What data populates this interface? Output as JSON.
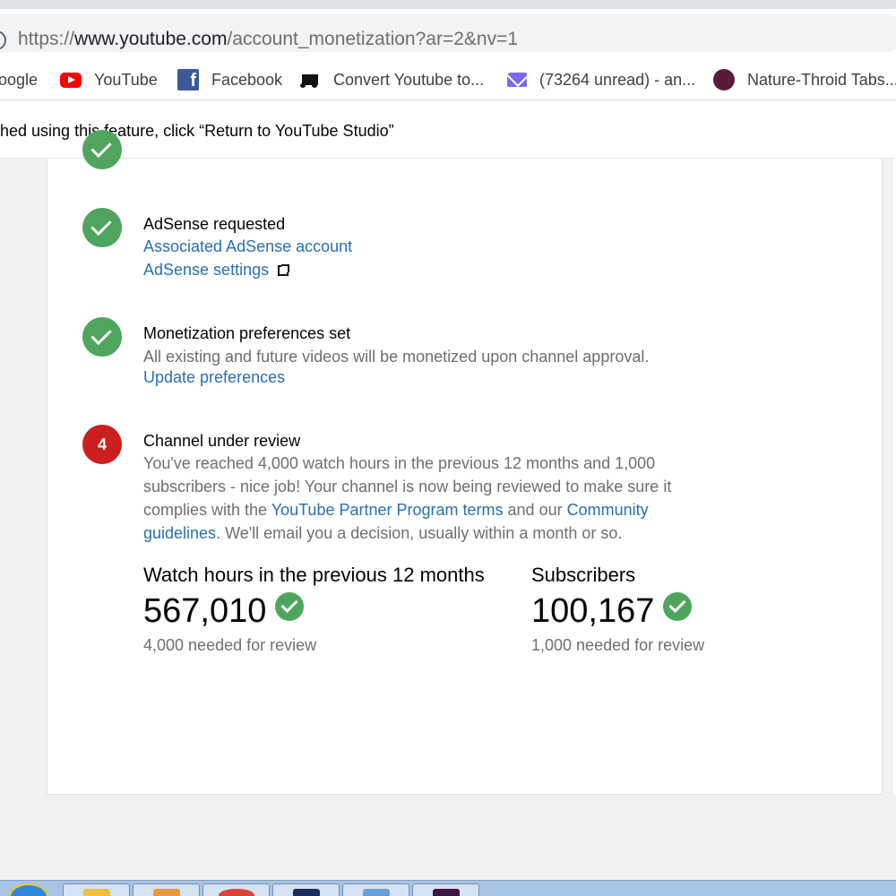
{
  "browser": {
    "url_scheme": "https://",
    "url_host": "www.youtube.com",
    "url_path": "/account_monetization?ar=2&nv=1",
    "info_glyph": "i",
    "bookmarks": [
      {
        "label": "oogle",
        "icon": "google"
      },
      {
        "label": "YouTube",
        "icon": "youtube-icon"
      },
      {
        "label": "Facebook",
        "icon": "facebook-icon"
      },
      {
        "label": "Convert Youtube to...",
        "icon": "music-note-icon"
      },
      {
        "label": "(73264 unread) - an...",
        "icon": "mail-icon"
      },
      {
        "label": "Nature-Throid Tabs...",
        "icon": "circle-icon"
      }
    ]
  },
  "banner": {
    "text": "hed using this feature, click “Return to YouTube Studio”"
  },
  "steps": {
    "adsense": {
      "title": "AdSense requested",
      "link1": "Associated AdSense account",
      "link2": "AdSense settings"
    },
    "monetization": {
      "title": "Monetization preferences set",
      "description": "All existing and future videos will be monetized upon channel approval.",
      "link": "Update preferences"
    },
    "review": {
      "number": "4",
      "title": "Channel under review",
      "desc_part1": "You've reached 4,000 watch hours in the previous 12 months and 1,000 subscribers - nice job! Your channel is now being reviewed to make sure it complies with the ",
      "link_ypp": "YouTube Partner Program terms",
      "desc_part2": " and our ",
      "link_community": "Community guidelines",
      "desc_part3": ". We'll email you a decision, usually within a month or so."
    }
  },
  "stats": {
    "watch": {
      "label": "Watch hours in the previous 12 months",
      "value": "567,010",
      "needed": "4,000 needed for review"
    },
    "subscribers": {
      "label": "Subscribers",
      "value": "100,167",
      "needed": "1,000 needed for review"
    }
  },
  "colors": {
    "success": "#4fa55d",
    "alert": "#cc1f1f",
    "link": "#2a6fb0"
  }
}
